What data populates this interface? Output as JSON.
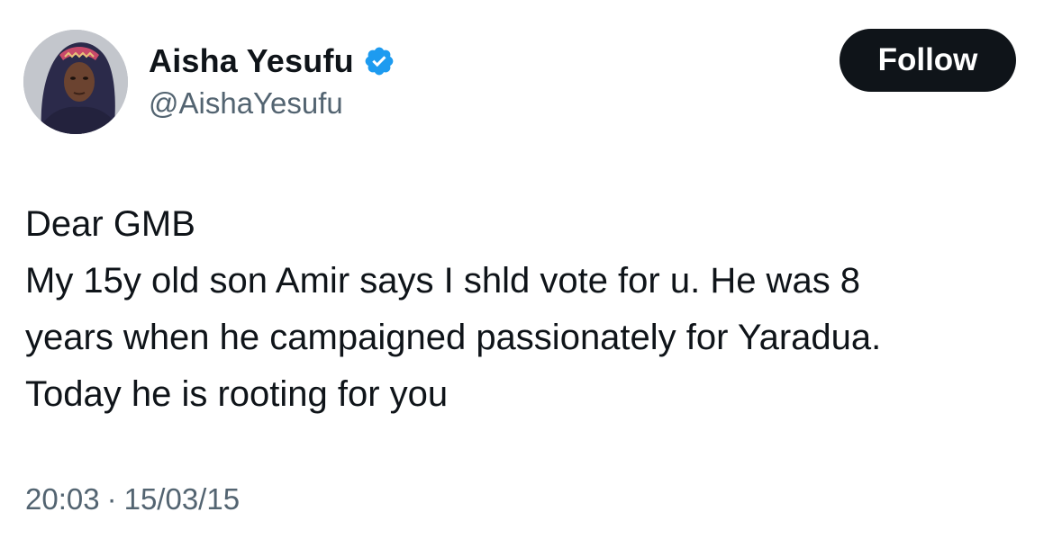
{
  "user": {
    "display_name": "Aisha Yesufu",
    "handle": "@AishaYesufu",
    "verified": true,
    "verified_badge_color": "#1d9bf0"
  },
  "follow_button": {
    "label": "Follow",
    "background": "#0f1419",
    "text_color": "#ffffff"
  },
  "tweet": {
    "lines": [
      "Dear GMB",
      "My 15y old son Amir says I shld vote for u. He was 8",
      "years when he campaigned passionately for Yaradua.",
      "Today he is rooting for you"
    ]
  },
  "meta": {
    "time": "20:03",
    "separator": "·",
    "date": "15/03/15"
  },
  "colors": {
    "text_primary": "#0f1419",
    "text_secondary": "#536471",
    "background": "#ffffff"
  }
}
